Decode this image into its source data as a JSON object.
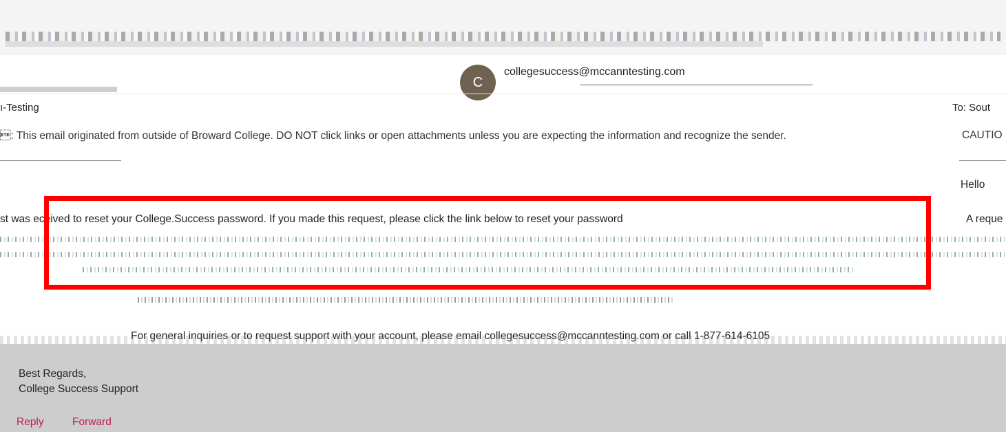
{
  "header": {
    "sender_initial": "C",
    "sender_email": "collegesuccess@mccanntesting.com"
  },
  "message": {
    "from_label": "ı-Testing",
    "to_label": "To: Sout",
    "caution_left": "\u0017: This email originated from outside of Broward College. DO NOT click links or open attachments unless you are expecting the information and recognize the sender.",
    "caution_right": "CAUTIO",
    "hello": "Hello",
    "reset_left": "st was eceived to reset your College.Success password. If you made this request, please click the link below to reset your password",
    "reset_right": "A reque",
    "inquiry": "For general inquiries or to request support with your account, please email collegesuccess@mccanntesting.com or call 1-877-614-6105",
    "regards": "Best Regards,",
    "signature": "College Success Support"
  },
  "actions": {
    "reply": "Reply",
    "forward": "Forward"
  },
  "colors": {
    "highlight": "#ff0000",
    "link": "#c2185b",
    "footer_bg": "#cdcdcd"
  }
}
